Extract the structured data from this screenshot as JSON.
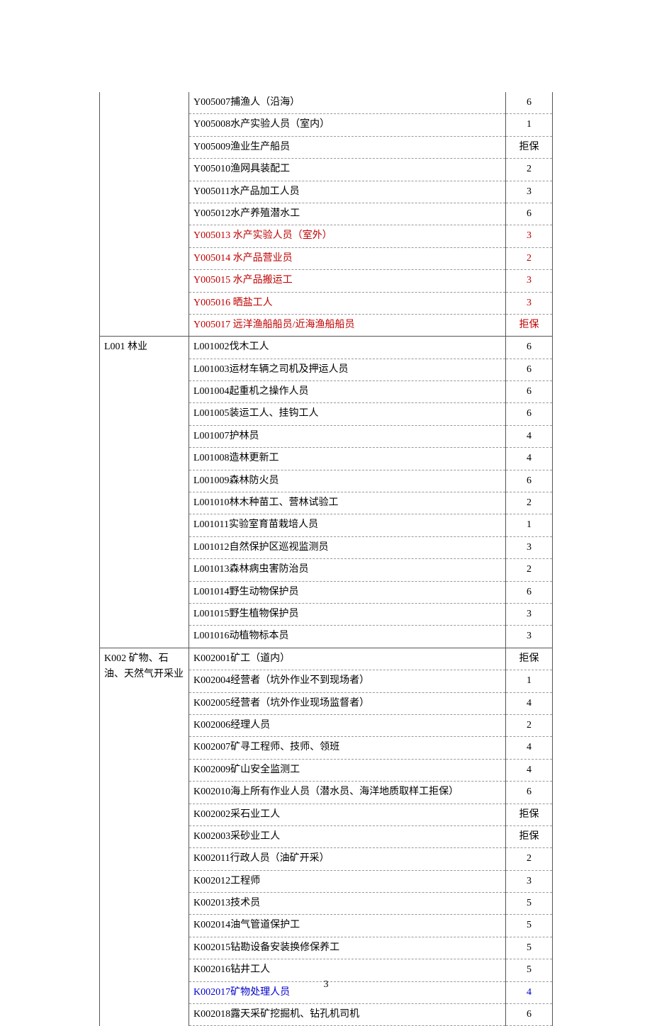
{
  "page_number": "3",
  "groups": [
    {
      "category": "",
      "rows": [
        {
          "desc": "Y005007捕渔人（沿海）",
          "level": "6",
          "color": ""
        },
        {
          "desc": "Y005008水产实验人员（室内）",
          "level": "1",
          "color": ""
        },
        {
          "desc": "Y005009渔业生产船员",
          "level": "拒保",
          "color": ""
        },
        {
          "desc": "Y005010渔网具装配工",
          "level": "2",
          "color": ""
        },
        {
          "desc": "Y005011水产品加工人员",
          "level": "3",
          "color": ""
        },
        {
          "desc": "Y005012水产养殖潜水工",
          "level": "6",
          "color": ""
        },
        {
          "desc": "Y005013 水产实验人员（室外）",
          "level": "3",
          "color": "red"
        },
        {
          "desc": "Y005014 水产品营业员",
          "level": "2",
          "color": "red"
        },
        {
          "desc": "Y005015 水产品搬运工",
          "level": "3",
          "color": "red"
        },
        {
          "desc": "Y005016 晒盐工人",
          "level": "3",
          "color": "red"
        },
        {
          "desc": "Y005017 远洋渔船船员/近海渔船船员",
          "level": "拒保",
          "color": "red"
        }
      ]
    },
    {
      "category": "L001 林业",
      "rows": [
        {
          "desc": "L001002伐木工人",
          "level": "6",
          "color": ""
        },
        {
          "desc": "L001003运材车辆之司机及押运人员",
          "level": "6",
          "color": ""
        },
        {
          "desc": "L001004起重机之操作人员",
          "level": "6",
          "color": ""
        },
        {
          "desc": "L001005装运工人、挂钩工人",
          "level": "6",
          "color": ""
        },
        {
          "desc": "L001007护林员",
          "level": "4",
          "color": ""
        },
        {
          "desc": "L001008造林更新工",
          "level": "4",
          "color": ""
        },
        {
          "desc": "L001009森林防火员",
          "level": "6",
          "color": ""
        },
        {
          "desc": "L001010林木种苗工、营林试验工",
          "level": "2",
          "color": ""
        },
        {
          "desc": "L001011实验室育苗栽培人员",
          "level": "1",
          "color": ""
        },
        {
          "desc": "L001012自然保护区巡视监测员",
          "level": "3",
          "color": ""
        },
        {
          "desc": "L001013森林病虫害防治员",
          "level": "2",
          "color": ""
        },
        {
          "desc": "L001014野生动物保护员",
          "level": "6",
          "color": ""
        },
        {
          "desc": "L001015野生植物保护员",
          "level": "3",
          "color": ""
        },
        {
          "desc": "L001016动植物标本员",
          "level": "3",
          "color": ""
        }
      ]
    },
    {
      "category": "K002 矿物、石油、天然气开采业",
      "rows": [
        {
          "desc": "K002001矿工（道内）",
          "level": "拒保",
          "color": ""
        },
        {
          "desc": "K002004经营者（坑外作业不到现场者）",
          "level": "1",
          "color": ""
        },
        {
          "desc": "K002005经营者（坑外作业现场监督者）",
          "level": "4",
          "color": ""
        },
        {
          "desc": "K002006经理人员",
          "level": "2",
          "color": ""
        },
        {
          "desc": "K002007矿寻工程师、技师、领班",
          "level": "4",
          "color": ""
        },
        {
          "desc": "K002009矿山安全监测工",
          "level": "4",
          "color": ""
        },
        {
          "desc": "K002010海上所有作业人员（潜水员、海洋地质取样工拒保）",
          "level": "6",
          "color": ""
        },
        {
          "desc": "K002002采石业工人",
          "level": "拒保",
          "color": ""
        },
        {
          "desc": "K002003采砂业工人",
          "level": "拒保",
          "color": ""
        },
        {
          "desc": "K002011行政人员（油矿开采）",
          "level": "2",
          "color": ""
        },
        {
          "desc": "K002012工程师",
          "level": "3",
          "color": ""
        },
        {
          "desc": "K002013技术员",
          "level": "5",
          "color": ""
        },
        {
          "desc": "K002014油气管道保护工",
          "level": "5",
          "color": ""
        },
        {
          "desc": "K002015钻勘设备安装换修保养工",
          "level": "5",
          "color": ""
        },
        {
          "desc": "K002016钻井工人",
          "level": "5",
          "color": ""
        },
        {
          "desc": "K002017矿物处理人员",
          "level": "4",
          "color": "blue"
        },
        {
          "desc": "K002018露天采矿挖掘机、钻孔机司机",
          "level": "6",
          "color": ""
        }
      ]
    }
  ]
}
